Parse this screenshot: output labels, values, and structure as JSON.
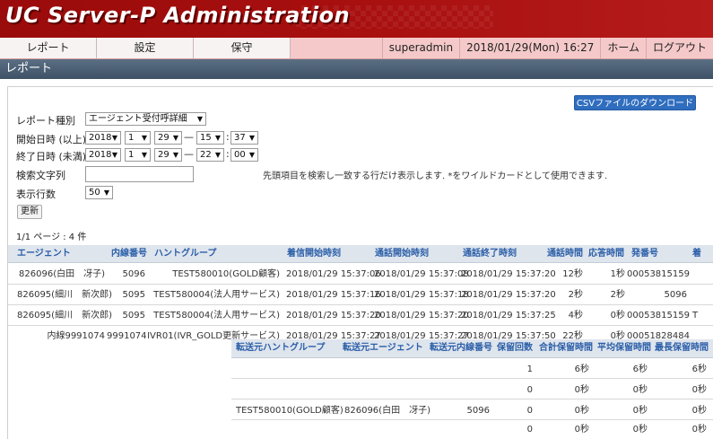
{
  "app": {
    "title": "UC Server-P Administration"
  },
  "menu": {
    "tabs": [
      "レポート",
      "設定",
      "保守"
    ],
    "user": "superadmin",
    "datetime": "2018/01/29(Mon) 16:27",
    "home": "ホーム",
    "logout": "ログアウト"
  },
  "page": {
    "title": "レポート"
  },
  "form": {
    "csv_button": "CSVファイルのダウンロード",
    "report_type_label": "レポート種別",
    "report_type_value": "エージェント受付呼詳細",
    "start_label": "開始日時 (以上)",
    "start": {
      "year": "2018",
      "month": "1",
      "day": "29",
      "hour": "15",
      "minute": "37"
    },
    "end_label": "終了日時 (未満)",
    "end": {
      "year": "2018",
      "month": "1",
      "day": "29",
      "hour": "22",
      "minute": "00"
    },
    "dash": "—",
    "colon": ":",
    "search_label": "検索文字列",
    "search_value": "",
    "search_hint": "先頭項目を検索し一致する行だけ表示します. *をワイルドカードとして使用できます.",
    "rows_label": "表示行数",
    "rows_value": "50",
    "update_button": "更新"
  },
  "result": {
    "page_info": "1/1 ページ : 4 件",
    "columns": [
      "エージェント",
      "内線番号",
      "ハントグループ",
      "着信開始時刻",
      "通話開始時刻",
      "通話終了時刻",
      "通話時間",
      "応答時間",
      "発番号",
      "着"
    ],
    "rows": [
      [
        "826096(白田　冴子)",
        "5096",
        "TEST580010(GOLD顧客)",
        "2018/01/29 15:37:06",
        "2018/01/29 15:37:08",
        "2018/01/29 15:37:20",
        "12秒",
        "1秒",
        "00053815159",
        ""
      ],
      [
        "826095(細川　新次郎)",
        "5095",
        "TEST580004(法人用サービス)",
        "2018/01/29 15:37:16",
        "2018/01/29 15:37:18",
        "2018/01/29 15:37:20",
        "2秒",
        "2秒",
        "5096",
        ""
      ],
      [
        "826095(細川　新次郎)",
        "5095",
        "TEST580004(法人用サービス)",
        "2018/01/29 15:37:20",
        "2018/01/29 15:37:20",
        "2018/01/29 15:37:25",
        "4秒",
        "0秒",
        "00053815159",
        "T"
      ],
      [
        "内線9991074",
        "9991074",
        "IVR01(IVR_GOLD更新サービス)",
        "2018/01/29 15:37:27",
        "2018/01/29 15:37:27",
        "2018/01/29 15:37:50",
        "22秒",
        "0秒",
        "00051828484",
        ""
      ]
    ]
  },
  "overlay": {
    "columns": [
      "転送元ハントグループ",
      "転送元エージェント",
      "転送元内線番号",
      "保留回数",
      "合計保留時間",
      "平均保留時間",
      "最長保留時間"
    ],
    "rows": [
      [
        "",
        "",
        "",
        "1",
        "6秒",
        "6秒",
        "6秒"
      ],
      [
        "",
        "",
        "",
        "0",
        "0秒",
        "0秒",
        "0秒"
      ],
      [
        "TEST580010(GOLD顧客)",
        "826096(白田　冴子)",
        "5096",
        "0",
        "0秒",
        "0秒",
        "0秒"
      ],
      [
        "",
        "",
        "",
        "0",
        "0秒",
        "0秒",
        "0秒"
      ]
    ]
  },
  "colors": {
    "banner": "#a80f0f",
    "menubar": "#f5c9c9",
    "titlebar": "#3e5166",
    "header_text": "#2a5ea8",
    "csv_button": "#2f6dbf"
  }
}
